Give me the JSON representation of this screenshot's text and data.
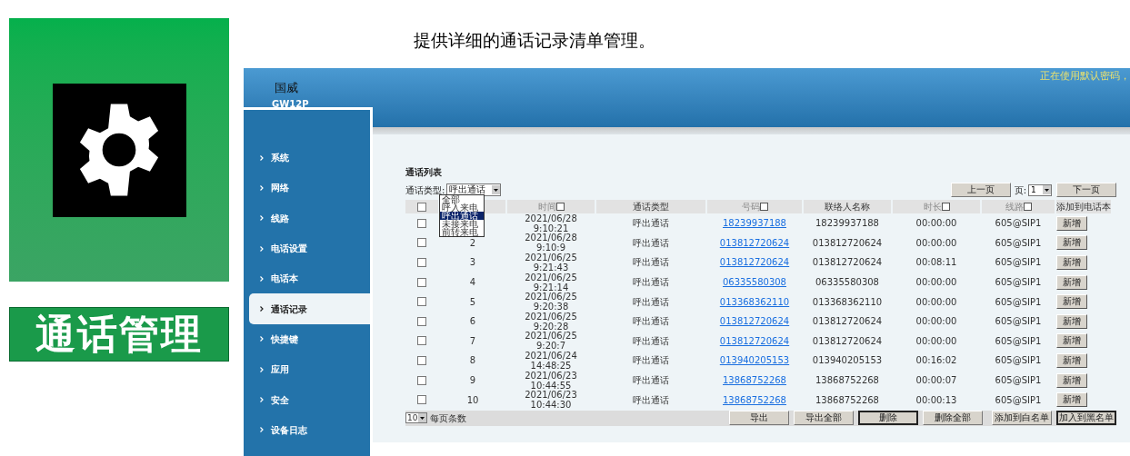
{
  "caption": "提供详细的通话记录清单管理。",
  "feature_card": {
    "label": "通话管理"
  },
  "header": {
    "brand": "国威",
    "model": "GW12P",
    "notice": "正在使用默认密码，"
  },
  "sidebar": {
    "items": [
      {
        "label": "系统",
        "selected": false
      },
      {
        "label": "网络",
        "selected": false
      },
      {
        "label": "线路",
        "selected": false
      },
      {
        "label": "电话设置",
        "selected": false
      },
      {
        "label": "电话本",
        "selected": false
      },
      {
        "label": "通话记录",
        "selected": true
      },
      {
        "label": "快捷键",
        "selected": false
      },
      {
        "label": "应用",
        "selected": false
      },
      {
        "label": "安全",
        "selected": false
      },
      {
        "label": "设备日志",
        "selected": false
      }
    ]
  },
  "section_title": "通话列表",
  "filter": {
    "label": "通话类型:",
    "value": "呼出通话",
    "options": [
      {
        "label": "全部",
        "selected": false
      },
      {
        "label": "呼入来电",
        "selected": false
      },
      {
        "label": "呼出通话",
        "selected": true
      },
      {
        "label": "未接来电",
        "selected": false
      },
      {
        "label": "前转来电",
        "selected": false
      }
    ]
  },
  "pager": {
    "prev": "上一页",
    "page_label": "页:",
    "page": "1",
    "next": "下一页"
  },
  "table": {
    "select_all_checked": false,
    "columns": [
      {
        "label": "时间",
        "sortable": true
      },
      {
        "label": "通话类型",
        "sortable": false
      },
      {
        "label": "号码",
        "sortable": true
      },
      {
        "label": "联络人名称",
        "sortable": false
      },
      {
        "label": "时长",
        "sortable": true
      },
      {
        "label": "线路",
        "sortable": true
      },
      {
        "label": "添加到电话本",
        "sortable": false
      }
    ],
    "rows": [
      {
        "index": "",
        "date": "2021/06/28",
        "time": "9:10:21",
        "type": "呼出通话",
        "number": "18239937188",
        "contact": "18239937188",
        "duration": "00:00:00",
        "line": "605@SIP1",
        "action": "新增",
        "checked": false
      },
      {
        "index": "2",
        "date": "2021/06/28",
        "time": "9:10:9",
        "type": "呼出通话",
        "number": "013812720624",
        "contact": "013812720624",
        "duration": "00:00:00",
        "line": "605@SIP1",
        "action": "新增",
        "checked": false
      },
      {
        "index": "3",
        "date": "2021/06/25",
        "time": "9:21:43",
        "type": "呼出通话",
        "number": "013812720624",
        "contact": "013812720624",
        "duration": "00:08:11",
        "line": "605@SIP1",
        "action": "新增",
        "checked": false
      },
      {
        "index": "4",
        "date": "2021/06/25",
        "time": "9:21:14",
        "type": "呼出通话",
        "number": "06335580308",
        "contact": "06335580308",
        "duration": "00:00:00",
        "line": "605@SIP1",
        "action": "新增",
        "checked": false
      },
      {
        "index": "5",
        "date": "2021/06/25",
        "time": "9:20:38",
        "type": "呼出通话",
        "number": "013368362110",
        "contact": "013368362110",
        "duration": "00:00:00",
        "line": "605@SIP1",
        "action": "新增",
        "checked": false
      },
      {
        "index": "6",
        "date": "2021/06/25",
        "time": "9:20:28",
        "type": "呼出通话",
        "number": "013812720624",
        "contact": "013812720624",
        "duration": "00:00:00",
        "line": "605@SIP1",
        "action": "新增",
        "checked": false
      },
      {
        "index": "7",
        "date": "2021/06/25",
        "time": "9:20:7",
        "type": "呼出通话",
        "number": "013812720624",
        "contact": "013812720624",
        "duration": "00:00:00",
        "line": "605@SIP1",
        "action": "新增",
        "checked": false
      },
      {
        "index": "8",
        "date": "2021/06/24",
        "time": "14:48:25",
        "type": "呼出通话",
        "number": "013940205153",
        "contact": "013940205153",
        "duration": "00:16:02",
        "line": "605@SIP1",
        "action": "新增",
        "checked": false
      },
      {
        "index": "9",
        "date": "2021/06/23",
        "time": "10:44:55",
        "type": "呼出通话",
        "number": "13868752268",
        "contact": "13868752268",
        "duration": "00:00:07",
        "line": "605@SIP1",
        "action": "新增",
        "checked": false
      },
      {
        "index": "10",
        "date": "2021/06/23",
        "time": "10:44:30",
        "type": "呼出通话",
        "number": "13868752268",
        "contact": "13868752268",
        "duration": "00:00:13",
        "line": "605@SIP1",
        "action": "新增",
        "checked": false
      }
    ]
  },
  "footer": {
    "page_size": "10",
    "page_size_label": "每页条数",
    "buttons": [
      {
        "label": "导出",
        "emphasized": false
      },
      {
        "label": "导出全部",
        "emphasized": false
      },
      {
        "label": "删除",
        "emphasized": true
      },
      {
        "label": "删除全部",
        "emphasized": false
      },
      {
        "label": "添加到白名单",
        "emphasized": false
      },
      {
        "label": "加入到黑名单",
        "emphasized": true
      }
    ]
  }
}
